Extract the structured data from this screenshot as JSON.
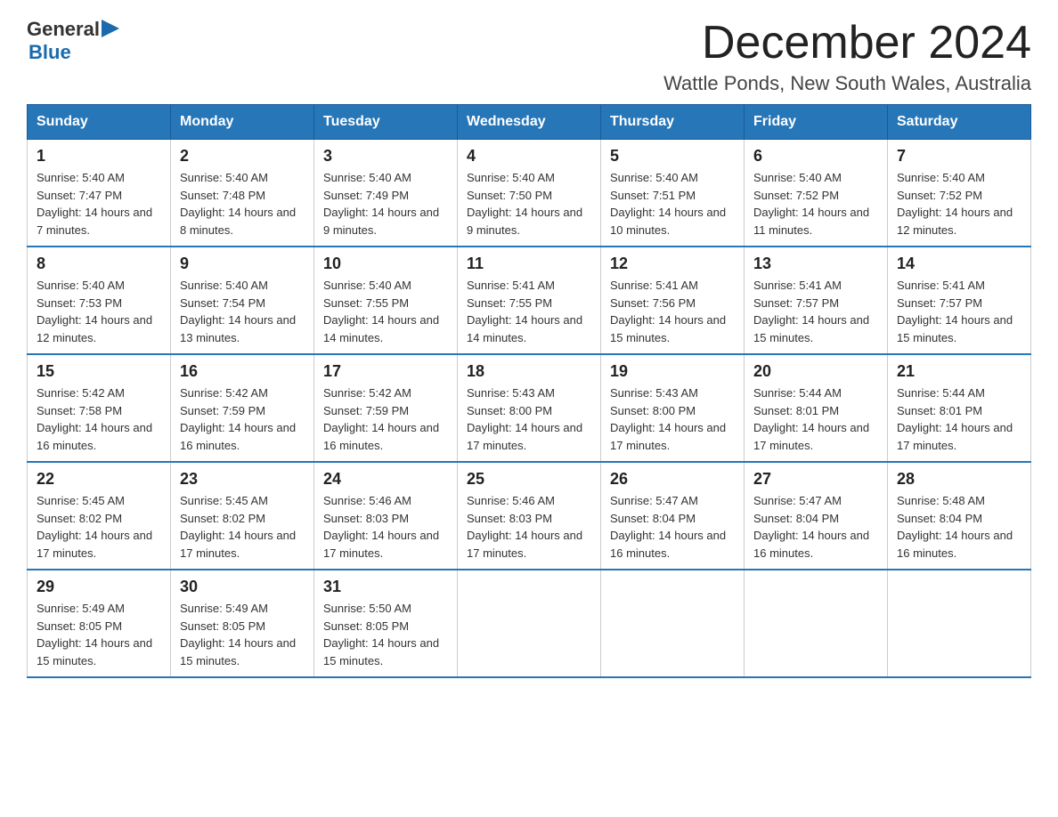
{
  "header": {
    "logo_general": "General",
    "logo_blue": "Blue",
    "month_title": "December 2024",
    "location": "Wattle Ponds, New South Wales, Australia"
  },
  "days_of_week": [
    "Sunday",
    "Monday",
    "Tuesday",
    "Wednesday",
    "Thursday",
    "Friday",
    "Saturday"
  ],
  "weeks": [
    [
      {
        "day": "1",
        "sunrise": "Sunrise: 5:40 AM",
        "sunset": "Sunset: 7:47 PM",
        "daylight": "Daylight: 14 hours and 7 minutes."
      },
      {
        "day": "2",
        "sunrise": "Sunrise: 5:40 AM",
        "sunset": "Sunset: 7:48 PM",
        "daylight": "Daylight: 14 hours and 8 minutes."
      },
      {
        "day": "3",
        "sunrise": "Sunrise: 5:40 AM",
        "sunset": "Sunset: 7:49 PM",
        "daylight": "Daylight: 14 hours and 9 minutes."
      },
      {
        "day": "4",
        "sunrise": "Sunrise: 5:40 AM",
        "sunset": "Sunset: 7:50 PM",
        "daylight": "Daylight: 14 hours and 9 minutes."
      },
      {
        "day": "5",
        "sunrise": "Sunrise: 5:40 AM",
        "sunset": "Sunset: 7:51 PM",
        "daylight": "Daylight: 14 hours and 10 minutes."
      },
      {
        "day": "6",
        "sunrise": "Sunrise: 5:40 AM",
        "sunset": "Sunset: 7:52 PM",
        "daylight": "Daylight: 14 hours and 11 minutes."
      },
      {
        "day": "7",
        "sunrise": "Sunrise: 5:40 AM",
        "sunset": "Sunset: 7:52 PM",
        "daylight": "Daylight: 14 hours and 12 minutes."
      }
    ],
    [
      {
        "day": "8",
        "sunrise": "Sunrise: 5:40 AM",
        "sunset": "Sunset: 7:53 PM",
        "daylight": "Daylight: 14 hours and 12 minutes."
      },
      {
        "day": "9",
        "sunrise": "Sunrise: 5:40 AM",
        "sunset": "Sunset: 7:54 PM",
        "daylight": "Daylight: 14 hours and 13 minutes."
      },
      {
        "day": "10",
        "sunrise": "Sunrise: 5:40 AM",
        "sunset": "Sunset: 7:55 PM",
        "daylight": "Daylight: 14 hours and 14 minutes."
      },
      {
        "day": "11",
        "sunrise": "Sunrise: 5:41 AM",
        "sunset": "Sunset: 7:55 PM",
        "daylight": "Daylight: 14 hours and 14 minutes."
      },
      {
        "day": "12",
        "sunrise": "Sunrise: 5:41 AM",
        "sunset": "Sunset: 7:56 PM",
        "daylight": "Daylight: 14 hours and 15 minutes."
      },
      {
        "day": "13",
        "sunrise": "Sunrise: 5:41 AM",
        "sunset": "Sunset: 7:57 PM",
        "daylight": "Daylight: 14 hours and 15 minutes."
      },
      {
        "day": "14",
        "sunrise": "Sunrise: 5:41 AM",
        "sunset": "Sunset: 7:57 PM",
        "daylight": "Daylight: 14 hours and 15 minutes."
      }
    ],
    [
      {
        "day": "15",
        "sunrise": "Sunrise: 5:42 AM",
        "sunset": "Sunset: 7:58 PM",
        "daylight": "Daylight: 14 hours and 16 minutes."
      },
      {
        "day": "16",
        "sunrise": "Sunrise: 5:42 AM",
        "sunset": "Sunset: 7:59 PM",
        "daylight": "Daylight: 14 hours and 16 minutes."
      },
      {
        "day": "17",
        "sunrise": "Sunrise: 5:42 AM",
        "sunset": "Sunset: 7:59 PM",
        "daylight": "Daylight: 14 hours and 16 minutes."
      },
      {
        "day": "18",
        "sunrise": "Sunrise: 5:43 AM",
        "sunset": "Sunset: 8:00 PM",
        "daylight": "Daylight: 14 hours and 17 minutes."
      },
      {
        "day": "19",
        "sunrise": "Sunrise: 5:43 AM",
        "sunset": "Sunset: 8:00 PM",
        "daylight": "Daylight: 14 hours and 17 minutes."
      },
      {
        "day": "20",
        "sunrise": "Sunrise: 5:44 AM",
        "sunset": "Sunset: 8:01 PM",
        "daylight": "Daylight: 14 hours and 17 minutes."
      },
      {
        "day": "21",
        "sunrise": "Sunrise: 5:44 AM",
        "sunset": "Sunset: 8:01 PM",
        "daylight": "Daylight: 14 hours and 17 minutes."
      }
    ],
    [
      {
        "day": "22",
        "sunrise": "Sunrise: 5:45 AM",
        "sunset": "Sunset: 8:02 PM",
        "daylight": "Daylight: 14 hours and 17 minutes."
      },
      {
        "day": "23",
        "sunrise": "Sunrise: 5:45 AM",
        "sunset": "Sunset: 8:02 PM",
        "daylight": "Daylight: 14 hours and 17 minutes."
      },
      {
        "day": "24",
        "sunrise": "Sunrise: 5:46 AM",
        "sunset": "Sunset: 8:03 PM",
        "daylight": "Daylight: 14 hours and 17 minutes."
      },
      {
        "day": "25",
        "sunrise": "Sunrise: 5:46 AM",
        "sunset": "Sunset: 8:03 PM",
        "daylight": "Daylight: 14 hours and 17 minutes."
      },
      {
        "day": "26",
        "sunrise": "Sunrise: 5:47 AM",
        "sunset": "Sunset: 8:04 PM",
        "daylight": "Daylight: 14 hours and 16 minutes."
      },
      {
        "day": "27",
        "sunrise": "Sunrise: 5:47 AM",
        "sunset": "Sunset: 8:04 PM",
        "daylight": "Daylight: 14 hours and 16 minutes."
      },
      {
        "day": "28",
        "sunrise": "Sunrise: 5:48 AM",
        "sunset": "Sunset: 8:04 PM",
        "daylight": "Daylight: 14 hours and 16 minutes."
      }
    ],
    [
      {
        "day": "29",
        "sunrise": "Sunrise: 5:49 AM",
        "sunset": "Sunset: 8:05 PM",
        "daylight": "Daylight: 14 hours and 15 minutes."
      },
      {
        "day": "30",
        "sunrise": "Sunrise: 5:49 AM",
        "sunset": "Sunset: 8:05 PM",
        "daylight": "Daylight: 14 hours and 15 minutes."
      },
      {
        "day": "31",
        "sunrise": "Sunrise: 5:50 AM",
        "sunset": "Sunset: 8:05 PM",
        "daylight": "Daylight: 14 hours and 15 minutes."
      },
      null,
      null,
      null,
      null
    ]
  ]
}
